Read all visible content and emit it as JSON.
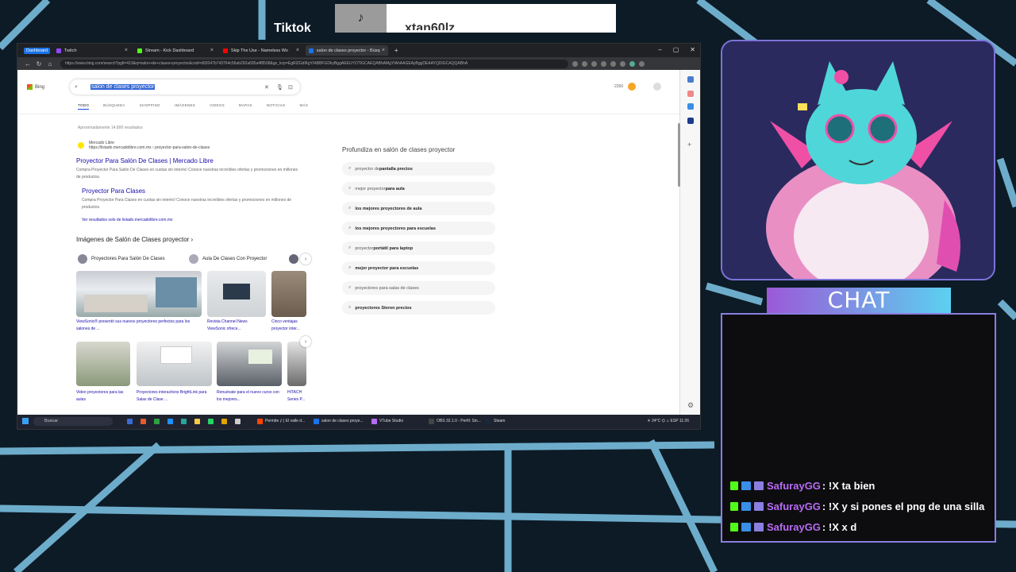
{
  "overlay": {
    "tiktok_label": "Tiktok",
    "tiktok_user": "xtan60lz",
    "chat_title": "CHAT"
  },
  "browser": {
    "profile": "Dashboard",
    "tabs": [
      {
        "label": "Twitch",
        "color": "#9146ff"
      },
      {
        "label": "Stream - Kick Dashboard",
        "color": "#53fc18"
      },
      {
        "label": "Skip The Use - Nameless Wo",
        "color": "#ff0000"
      },
      {
        "label": "salon de clases proyector - Búsq",
        "color": "#1a73e8",
        "active": true
      }
    ],
    "url": "https://www.bing.com/search?pglt=419&q=salon+de+clases+proyector&cvid=d02047b743764c56ab292a695a4f8508&gs_lcrp=EgRlZGdlKgYIABBFGDkyBggAEEUYOTIGCAEQABhAMgYIAhAAGEAyBggDEAAYQDIGCAQQABhA"
  },
  "bing": {
    "logo": "Bing",
    "query": "salon de clases proyector",
    "nav_tabs": [
      "TODO",
      "BÚSQUEDA",
      "SHOPPING",
      "IMÁGENES",
      "VIDEOS",
      "MAPAS",
      "NOTICIAS",
      "MÁS"
    ],
    "points": "2260",
    "results_count": "Aproximadamente 14.800 resultados",
    "result1": {
      "site_name": "Mercado Libre",
      "site_url": "https://listado.mercadolibre.com.mx › proyector-para-salon-de-clases",
      "title": "Proyector Para Salón De Clases | Mercado Libre",
      "desc": "Compra Proyector Para Salón De Clases en cuotas sin interés! Conoce nuestras increíbles ofertas y promociones en millones de productos.",
      "sub_title": "Proyector Para Clases",
      "sub_desc": "Compra Proyector Para Clases en cuotas sin interés! Conoce nuestras increíbles ofertas y promociones en millones de productos.",
      "more": "Ver resultados solo de listado.mercadolibre.com.mx"
    },
    "images_title": "Imágenes de Salón de Clases proyector ›",
    "image_pills": [
      "Proyectores Para Salón De Clases",
      "Aula De Clases Con Proyector"
    ],
    "image_captions": [
      "ViewSonic® presentó sus nuevos proyectores perfectos para los salones de ...",
      "Revista Channel News ViewSonic ofrece...",
      "Cinco ventajas proyector inter...",
      "Video proyectores para las aulas",
      "Proyectores interactivos BrightLink para Salas de Clase ...",
      "Renuévate para el nuevo curso con los mejores...",
      "HITACH Series P..."
    ],
    "related_title": "Profundiza en salón de clases proyector",
    "related": [
      {
        "pre": "proyector de ",
        "bold": "pantalla precios"
      },
      {
        "pre": "mejor proyector ",
        "bold": "para aula"
      },
      {
        "pre": "",
        "bold": "los mejores proyectores de aula"
      },
      {
        "pre": "",
        "bold": "los mejores proyectores para escuelas"
      },
      {
        "pre": "proyector ",
        "bold": "portátil para laptop"
      },
      {
        "pre": "",
        "bold": "mejor proyector para escuelas"
      },
      {
        "pre": "proyectores para salas de clases",
        "bold": ""
      },
      {
        "pre": "",
        "bold": "proyectores Steren precios"
      }
    ]
  },
  "taskbar": {
    "search": "Buscar",
    "apps": [
      "Permite ¡! | El valle d...",
      "salon de clases proye...",
      "VTube Studio",
      "OBS 32.1.0 - Perfil: Sin...",
      "Steam"
    ],
    "weather": "24°C",
    "lang": "ESP",
    "time": "11:26"
  },
  "chat": [
    {
      "user": "SafurayGG",
      "msg": ": !X ta bien"
    },
    {
      "user": "SafurayGG",
      "msg": ": !X y si pones el png de una silla"
    },
    {
      "user": "SafurayGG",
      "msg": ": !X x d"
    }
  ],
  "colors": {
    "accent": "#8a7ee0",
    "link": "#1a0dab",
    "chat_user": "#b76bf3"
  }
}
